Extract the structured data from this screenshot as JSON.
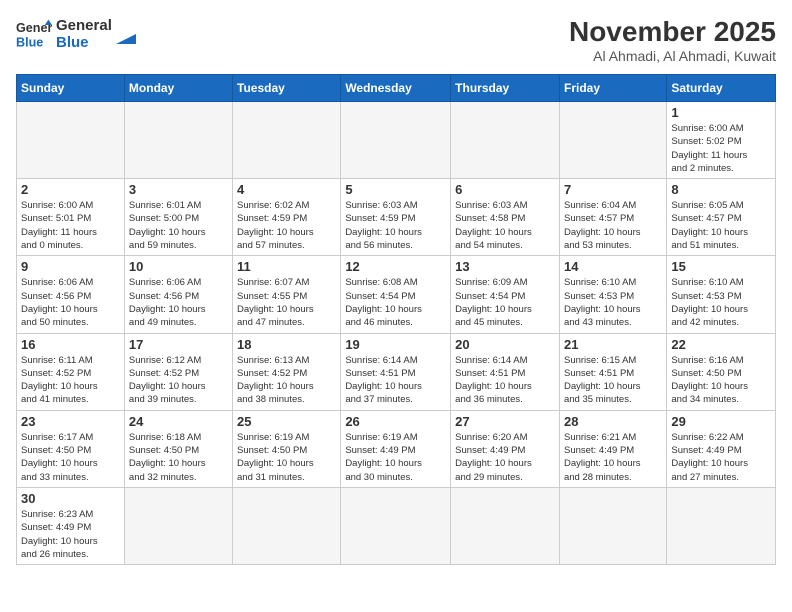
{
  "logo": {
    "line1": "General",
    "line2": "Blue"
  },
  "title": "November 2025",
  "location": "Al Ahmadi, Al Ahmadi, Kuwait",
  "days_of_week": [
    "Sunday",
    "Monday",
    "Tuesday",
    "Wednesday",
    "Thursday",
    "Friday",
    "Saturday"
  ],
  "weeks": [
    [
      {
        "day": "",
        "info": ""
      },
      {
        "day": "",
        "info": ""
      },
      {
        "day": "",
        "info": ""
      },
      {
        "day": "",
        "info": ""
      },
      {
        "day": "",
        "info": ""
      },
      {
        "day": "",
        "info": ""
      },
      {
        "day": "1",
        "info": "Sunrise: 6:00 AM\nSunset: 5:02 PM\nDaylight: 11 hours\nand 2 minutes."
      }
    ],
    [
      {
        "day": "2",
        "info": "Sunrise: 6:00 AM\nSunset: 5:01 PM\nDaylight: 11 hours\nand 0 minutes."
      },
      {
        "day": "3",
        "info": "Sunrise: 6:01 AM\nSunset: 5:00 PM\nDaylight: 10 hours\nand 59 minutes."
      },
      {
        "day": "4",
        "info": "Sunrise: 6:02 AM\nSunset: 4:59 PM\nDaylight: 10 hours\nand 57 minutes."
      },
      {
        "day": "5",
        "info": "Sunrise: 6:03 AM\nSunset: 4:59 PM\nDaylight: 10 hours\nand 56 minutes."
      },
      {
        "day": "6",
        "info": "Sunrise: 6:03 AM\nSunset: 4:58 PM\nDaylight: 10 hours\nand 54 minutes."
      },
      {
        "day": "7",
        "info": "Sunrise: 6:04 AM\nSunset: 4:57 PM\nDaylight: 10 hours\nand 53 minutes."
      },
      {
        "day": "8",
        "info": "Sunrise: 6:05 AM\nSunset: 4:57 PM\nDaylight: 10 hours\nand 51 minutes."
      }
    ],
    [
      {
        "day": "9",
        "info": "Sunrise: 6:06 AM\nSunset: 4:56 PM\nDaylight: 10 hours\nand 50 minutes."
      },
      {
        "day": "10",
        "info": "Sunrise: 6:06 AM\nSunset: 4:56 PM\nDaylight: 10 hours\nand 49 minutes."
      },
      {
        "day": "11",
        "info": "Sunrise: 6:07 AM\nSunset: 4:55 PM\nDaylight: 10 hours\nand 47 minutes."
      },
      {
        "day": "12",
        "info": "Sunrise: 6:08 AM\nSunset: 4:54 PM\nDaylight: 10 hours\nand 46 minutes."
      },
      {
        "day": "13",
        "info": "Sunrise: 6:09 AM\nSunset: 4:54 PM\nDaylight: 10 hours\nand 45 minutes."
      },
      {
        "day": "14",
        "info": "Sunrise: 6:10 AM\nSunset: 4:53 PM\nDaylight: 10 hours\nand 43 minutes."
      },
      {
        "day": "15",
        "info": "Sunrise: 6:10 AM\nSunset: 4:53 PM\nDaylight: 10 hours\nand 42 minutes."
      }
    ],
    [
      {
        "day": "16",
        "info": "Sunrise: 6:11 AM\nSunset: 4:52 PM\nDaylight: 10 hours\nand 41 minutes."
      },
      {
        "day": "17",
        "info": "Sunrise: 6:12 AM\nSunset: 4:52 PM\nDaylight: 10 hours\nand 39 minutes."
      },
      {
        "day": "18",
        "info": "Sunrise: 6:13 AM\nSunset: 4:52 PM\nDaylight: 10 hours\nand 38 minutes."
      },
      {
        "day": "19",
        "info": "Sunrise: 6:14 AM\nSunset: 4:51 PM\nDaylight: 10 hours\nand 37 minutes."
      },
      {
        "day": "20",
        "info": "Sunrise: 6:14 AM\nSunset: 4:51 PM\nDaylight: 10 hours\nand 36 minutes."
      },
      {
        "day": "21",
        "info": "Sunrise: 6:15 AM\nSunset: 4:51 PM\nDaylight: 10 hours\nand 35 minutes."
      },
      {
        "day": "22",
        "info": "Sunrise: 6:16 AM\nSunset: 4:50 PM\nDaylight: 10 hours\nand 34 minutes."
      }
    ],
    [
      {
        "day": "23",
        "info": "Sunrise: 6:17 AM\nSunset: 4:50 PM\nDaylight: 10 hours\nand 33 minutes."
      },
      {
        "day": "24",
        "info": "Sunrise: 6:18 AM\nSunset: 4:50 PM\nDaylight: 10 hours\nand 32 minutes."
      },
      {
        "day": "25",
        "info": "Sunrise: 6:19 AM\nSunset: 4:50 PM\nDaylight: 10 hours\nand 31 minutes."
      },
      {
        "day": "26",
        "info": "Sunrise: 6:19 AM\nSunset: 4:49 PM\nDaylight: 10 hours\nand 30 minutes."
      },
      {
        "day": "27",
        "info": "Sunrise: 6:20 AM\nSunset: 4:49 PM\nDaylight: 10 hours\nand 29 minutes."
      },
      {
        "day": "28",
        "info": "Sunrise: 6:21 AM\nSunset: 4:49 PM\nDaylight: 10 hours\nand 28 minutes."
      },
      {
        "day": "29",
        "info": "Sunrise: 6:22 AM\nSunset: 4:49 PM\nDaylight: 10 hours\nand 27 minutes."
      }
    ],
    [
      {
        "day": "30",
        "info": "Sunrise: 6:23 AM\nSunset: 4:49 PM\nDaylight: 10 hours\nand 26 minutes."
      },
      {
        "day": "",
        "info": ""
      },
      {
        "day": "",
        "info": ""
      },
      {
        "day": "",
        "info": ""
      },
      {
        "day": "",
        "info": ""
      },
      {
        "day": "",
        "info": ""
      },
      {
        "day": "",
        "info": ""
      }
    ]
  ]
}
